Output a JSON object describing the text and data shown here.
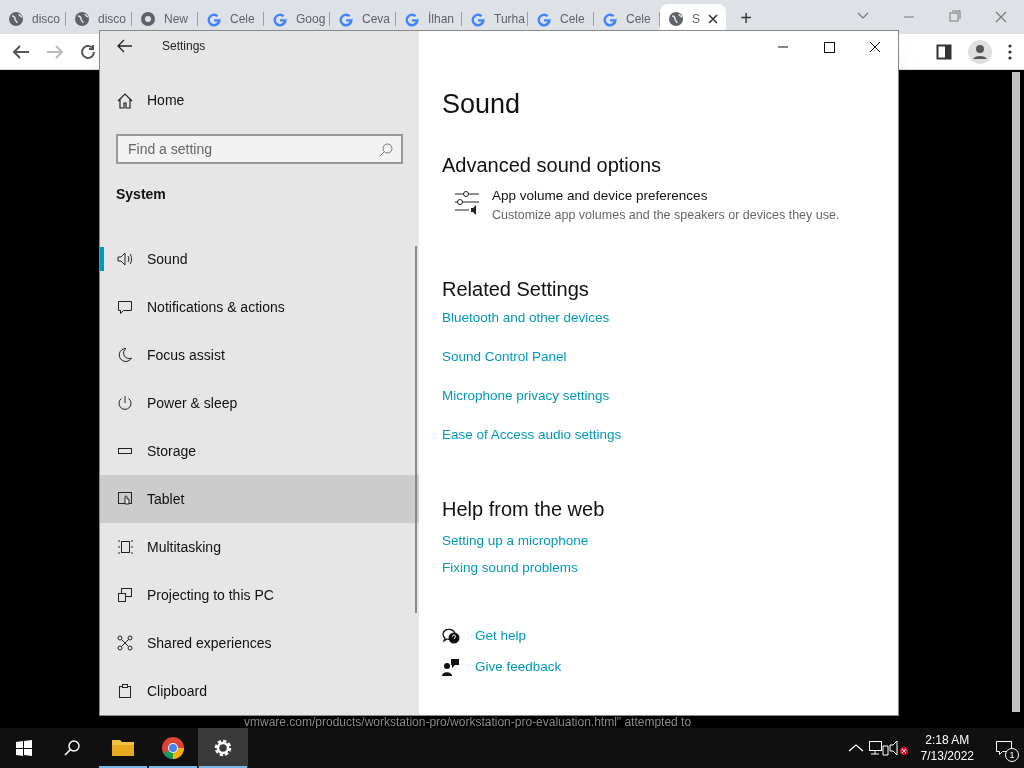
{
  "browser": {
    "tabs": [
      {
        "label": "disco",
        "selected": false
      },
      {
        "label": "disco",
        "selected": false
      },
      {
        "label": "New",
        "selected": false
      },
      {
        "label": "Cele",
        "selected": false
      },
      {
        "label": "Goog",
        "selected": false
      },
      {
        "label": "Ceva",
        "selected": false
      },
      {
        "label": "İlhan",
        "selected": false
      },
      {
        "label": "Turha",
        "selected": false
      },
      {
        "label": "Cele",
        "selected": false
      },
      {
        "label": "Cele",
        "selected": false
      },
      {
        "label": "S",
        "selected": true
      }
    ],
    "new_tab": "+",
    "page_text": "vmware.com/products/workstation-pro/workstation-pro-evaluation.html\"  attempted to"
  },
  "window": {
    "title": "Settings"
  },
  "sidebar": {
    "home": "Home",
    "search": {
      "placeholder": "Find a setting"
    },
    "section": "System",
    "items": [
      {
        "label": "Sound",
        "selected": true,
        "hovered": false
      },
      {
        "label": "Notifications & actions",
        "selected": false,
        "hovered": false
      },
      {
        "label": "Focus assist",
        "selected": false,
        "hovered": false
      },
      {
        "label": "Power & sleep",
        "selected": false,
        "hovered": false
      },
      {
        "label": "Storage",
        "selected": false,
        "hovered": false
      },
      {
        "label": "Tablet",
        "selected": false,
        "hovered": true
      },
      {
        "label": "Multitasking",
        "selected": false,
        "hovered": false
      },
      {
        "label": "Projecting to this PC",
        "selected": false,
        "hovered": false
      },
      {
        "label": "Shared experiences",
        "selected": false,
        "hovered": false
      },
      {
        "label": "Clipboard",
        "selected": false,
        "hovered": false
      }
    ]
  },
  "content": {
    "title": "Sound",
    "advanced": {
      "heading": "Advanced sound options",
      "item_title": "App volume and device preferences",
      "item_desc": "Customize app volumes and the speakers or devices they use."
    },
    "related": {
      "heading": "Related Settings",
      "links": [
        "Bluetooth and other devices",
        "Sound Control Panel",
        "Microphone privacy settings",
        "Ease of Access audio settings"
      ]
    },
    "help": {
      "heading": "Help from the web",
      "links": [
        "Setting up a microphone",
        "Fixing sound problems"
      ]
    },
    "get_help": "Get help",
    "give_feedback": "Give feedback"
  },
  "taskbar": {
    "apps": [
      {
        "selected": false
      },
      {
        "selected": false
      },
      {
        "selected": true
      }
    ],
    "time": "2:18 AM",
    "date": "7/13/2022",
    "notifications": "1"
  }
}
